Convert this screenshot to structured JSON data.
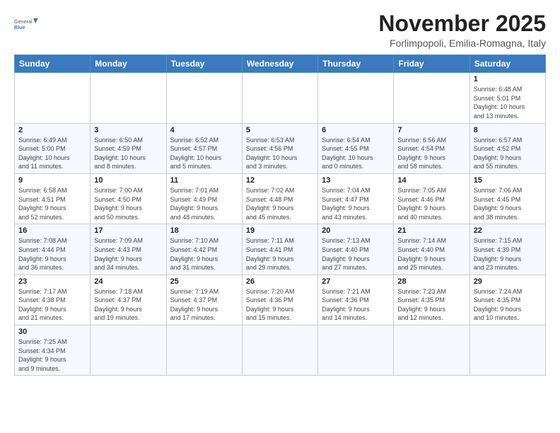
{
  "logo": {
    "text_general": "General",
    "text_blue": "Blue"
  },
  "header": {
    "month": "November 2025",
    "location": "Forlimpopoli, Emilia-Romagna, Italy"
  },
  "weekdays": [
    "Sunday",
    "Monday",
    "Tuesday",
    "Wednesday",
    "Thursday",
    "Friday",
    "Saturday"
  ],
  "weeks": [
    [
      {
        "day": "",
        "info": ""
      },
      {
        "day": "",
        "info": ""
      },
      {
        "day": "",
        "info": ""
      },
      {
        "day": "",
        "info": ""
      },
      {
        "day": "",
        "info": ""
      },
      {
        "day": "",
        "info": ""
      },
      {
        "day": "1",
        "info": "Sunrise: 6:48 AM\nSunset: 5:01 PM\nDaylight: 10 hours\nand 13 minutes."
      }
    ],
    [
      {
        "day": "2",
        "info": "Sunrise: 6:49 AM\nSunset: 5:00 PM\nDaylight: 10 hours\nand 11 minutes."
      },
      {
        "day": "3",
        "info": "Sunrise: 6:50 AM\nSunset: 4:59 PM\nDaylight: 10 hours\nand 8 minutes."
      },
      {
        "day": "4",
        "info": "Sunrise: 6:52 AM\nSunset: 4:57 PM\nDaylight: 10 hours\nand 5 minutes."
      },
      {
        "day": "5",
        "info": "Sunrise: 6:53 AM\nSunset: 4:56 PM\nDaylight: 10 hours\nand 3 minutes."
      },
      {
        "day": "6",
        "info": "Sunrise: 6:54 AM\nSunset: 4:55 PM\nDaylight: 10 hours\nand 0 minutes."
      },
      {
        "day": "7",
        "info": "Sunrise: 6:56 AM\nSunset: 4:54 PM\nDaylight: 9 hours\nand 58 minutes."
      },
      {
        "day": "8",
        "info": "Sunrise: 6:57 AM\nSunset: 4:52 PM\nDaylight: 9 hours\nand 55 minutes."
      }
    ],
    [
      {
        "day": "9",
        "info": "Sunrise: 6:58 AM\nSunset: 4:51 PM\nDaylight: 9 hours\nand 52 minutes."
      },
      {
        "day": "10",
        "info": "Sunrise: 7:00 AM\nSunset: 4:50 PM\nDaylight: 9 hours\nand 50 minutes."
      },
      {
        "day": "11",
        "info": "Sunrise: 7:01 AM\nSunset: 4:49 PM\nDaylight: 9 hours\nand 48 minutes."
      },
      {
        "day": "12",
        "info": "Sunrise: 7:02 AM\nSunset: 4:48 PM\nDaylight: 9 hours\nand 45 minutes."
      },
      {
        "day": "13",
        "info": "Sunrise: 7:04 AM\nSunset: 4:47 PM\nDaylight: 9 hours\nand 43 minutes."
      },
      {
        "day": "14",
        "info": "Sunrise: 7:05 AM\nSunset: 4:46 PM\nDaylight: 9 hours\nand 40 minutes."
      },
      {
        "day": "15",
        "info": "Sunrise: 7:06 AM\nSunset: 4:45 PM\nDaylight: 9 hours\nand 38 minutes."
      }
    ],
    [
      {
        "day": "16",
        "info": "Sunrise: 7:08 AM\nSunset: 4:44 PM\nDaylight: 9 hours\nand 36 minutes."
      },
      {
        "day": "17",
        "info": "Sunrise: 7:09 AM\nSunset: 4:43 PM\nDaylight: 9 hours\nand 34 minutes."
      },
      {
        "day": "18",
        "info": "Sunrise: 7:10 AM\nSunset: 4:42 PM\nDaylight: 9 hours\nand 31 minutes."
      },
      {
        "day": "19",
        "info": "Sunrise: 7:11 AM\nSunset: 4:41 PM\nDaylight: 9 hours\nand 29 minutes."
      },
      {
        "day": "20",
        "info": "Sunrise: 7:13 AM\nSunset: 4:40 PM\nDaylight: 9 hours\nand 27 minutes."
      },
      {
        "day": "21",
        "info": "Sunrise: 7:14 AM\nSunset: 4:40 PM\nDaylight: 9 hours\nand 25 minutes."
      },
      {
        "day": "22",
        "info": "Sunrise: 7:15 AM\nSunset: 4:39 PM\nDaylight: 9 hours\nand 23 minutes."
      }
    ],
    [
      {
        "day": "23",
        "info": "Sunrise: 7:17 AM\nSunset: 4:38 PM\nDaylight: 9 hours\nand 21 minutes."
      },
      {
        "day": "24",
        "info": "Sunrise: 7:18 AM\nSunset: 4:37 PM\nDaylight: 9 hours\nand 19 minutes."
      },
      {
        "day": "25",
        "info": "Sunrise: 7:19 AM\nSunset: 4:37 PM\nDaylight: 9 hours\nand 17 minutes."
      },
      {
        "day": "26",
        "info": "Sunrise: 7:20 AM\nSunset: 4:36 PM\nDaylight: 9 hours\nand 15 minutes."
      },
      {
        "day": "27",
        "info": "Sunrise: 7:21 AM\nSunset: 4:36 PM\nDaylight: 9 hours\nand 14 minutes."
      },
      {
        "day": "28",
        "info": "Sunrise: 7:23 AM\nSunset: 4:35 PM\nDaylight: 9 hours\nand 12 minutes."
      },
      {
        "day": "29",
        "info": "Sunrise: 7:24 AM\nSunset: 4:35 PM\nDaylight: 9 hours\nand 10 minutes."
      }
    ],
    [
      {
        "day": "30",
        "info": "Sunrise: 7:25 AM\nSunset: 4:34 PM\nDaylight: 9 hours\nand 9 minutes."
      },
      {
        "day": "",
        "info": ""
      },
      {
        "day": "",
        "info": ""
      },
      {
        "day": "",
        "info": ""
      },
      {
        "day": "",
        "info": ""
      },
      {
        "day": "",
        "info": ""
      },
      {
        "day": "",
        "info": ""
      }
    ]
  ]
}
